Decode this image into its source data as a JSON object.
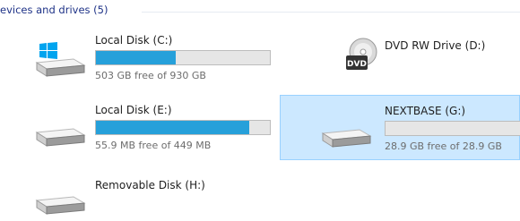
{
  "group": {
    "title": "evices and drives (5)"
  },
  "drives": [
    {
      "name": "Local Disk (C:)",
      "free": "503 GB free of 930 GB",
      "used_fraction": 0.46,
      "icon": "windows-disk-icon",
      "selected": false
    },
    {
      "name": "DVD RW Drive (D:)",
      "icon": "dvd-drive-icon",
      "selected": false
    },
    {
      "name": "Local Disk (E:)",
      "free": "55.9 MB free of 449 MB",
      "used_fraction": 0.88,
      "icon": "hard-disk-icon",
      "selected": false
    },
    {
      "name": "NEXTBASE (G:)",
      "free": "28.9 GB free of 28.9 GB",
      "used_fraction": 0.0,
      "icon": "removable-disk-icon",
      "selected": true
    },
    {
      "name": "Removable Disk (H:)",
      "icon": "removable-disk-icon",
      "selected": false
    }
  ],
  "colors": {
    "bar_fill": "#26a0da",
    "selection": "#cce8ff",
    "header": "#1e3287"
  }
}
